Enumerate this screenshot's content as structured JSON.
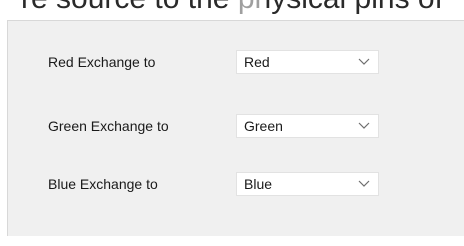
{
  "background_text": "re source to the physical pins of",
  "exchange": {
    "rows": [
      {
        "label": "Red Exchange to",
        "value": "Red"
      },
      {
        "label": "Green Exchange to",
        "value": "Green"
      },
      {
        "label": "Blue Exchange to",
        "value": "Blue"
      }
    ]
  },
  "icons": {
    "dropdown": "chevron-down-icon"
  },
  "colors": {
    "panel_bg": "#f0f0f0",
    "combo_bg": "#ffffff",
    "combo_border": "#e2e2e2"
  }
}
